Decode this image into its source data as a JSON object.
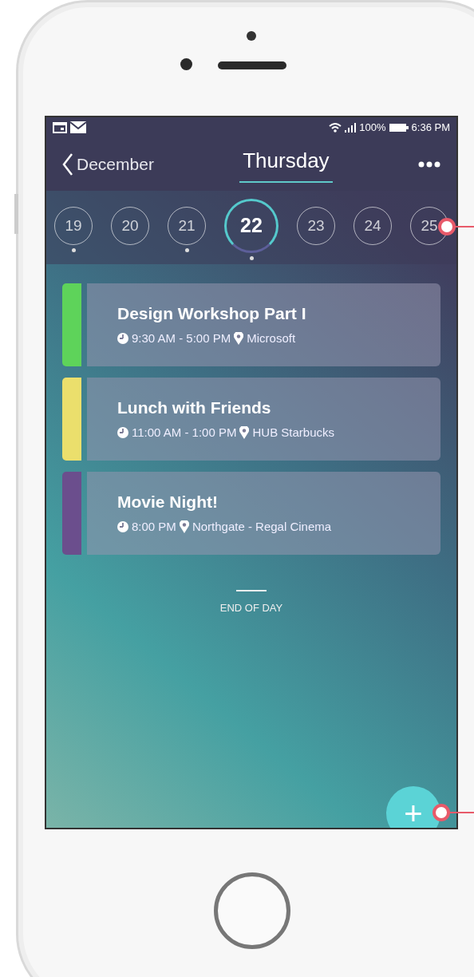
{
  "status_bar": {
    "battery": "100%",
    "time": "6:36 PM"
  },
  "header": {
    "back_label": "December",
    "title": "Thursday"
  },
  "days": [
    {
      "label": "19",
      "selected": false,
      "has_events": true
    },
    {
      "label": "20",
      "selected": false,
      "has_events": false
    },
    {
      "label": "21",
      "selected": false,
      "has_events": true
    },
    {
      "label": "22",
      "selected": true,
      "has_events": true
    },
    {
      "label": "23",
      "selected": false,
      "has_events": false
    },
    {
      "label": "24",
      "selected": false,
      "has_events": false
    },
    {
      "label": "25",
      "selected": false,
      "has_events": false
    }
  ],
  "events": [
    {
      "title": "Design Workshop Part I",
      "time": "9:30 AM - 5:00 PM",
      "location": "Microsoft",
      "color": "#5ed35a"
    },
    {
      "title": "Lunch with Friends",
      "time": "11:00 AM - 1:00 PM",
      "location": "HUB Starbucks",
      "color": "#ebdf6c"
    },
    {
      "title": "Movie Night!",
      "time": "8:00 PM",
      "location": "Northgate - Regal Cinema",
      "color": "#6b4e8d"
    }
  ],
  "end_label": "END OF DAY",
  "add_button": "+"
}
